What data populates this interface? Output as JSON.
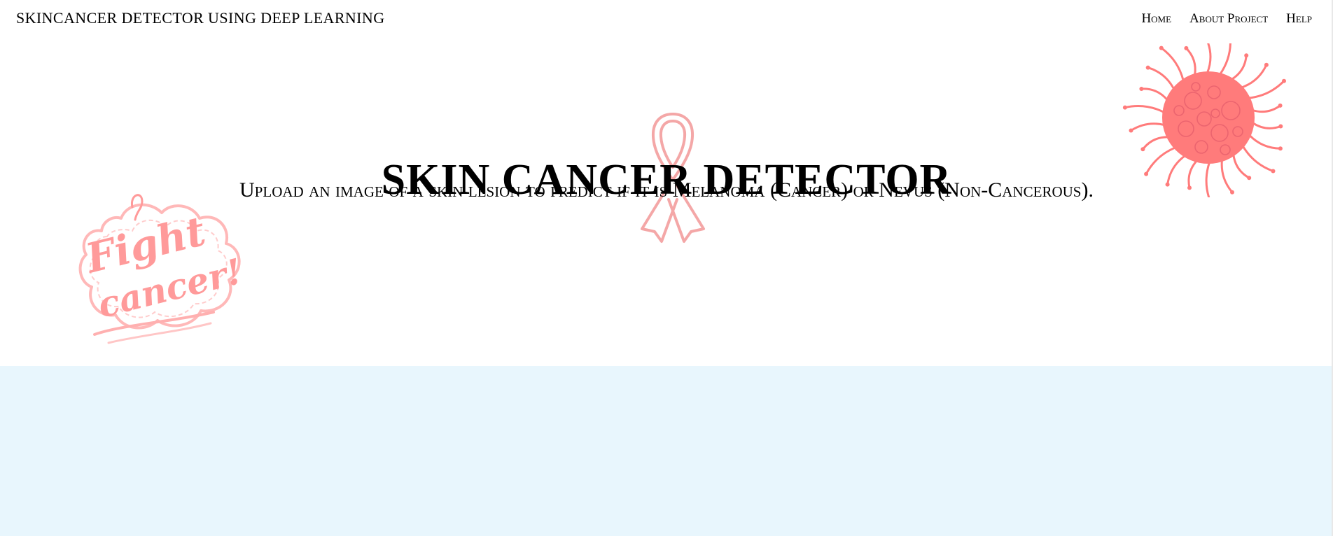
{
  "header": {
    "brand": "SKINCANCER DETECTOR USING DEEP LEARNING",
    "nav": [
      {
        "label": "Home"
      },
      {
        "label": "About Project"
      },
      {
        "label": "Help"
      }
    ]
  },
  "hero": {
    "title": "SKIN CANCER DETECTOR",
    "subtitle": "Upload an image of a skin lesion to predict if it is Melanoma (Cancer) or Nevus (Non-Cancerous).",
    "decor_text": "Fight cancer!"
  },
  "colors": {
    "accent": "#ff7b7b",
    "ribbon": "#f4a7a7",
    "lower_section": "#e8f6fd",
    "background": "#ffffff"
  },
  "icons": {
    "ribbon": "awareness-ribbon-icon",
    "cell": "cancer-cell-icon",
    "sticker": "fight-cancer-sticker"
  }
}
